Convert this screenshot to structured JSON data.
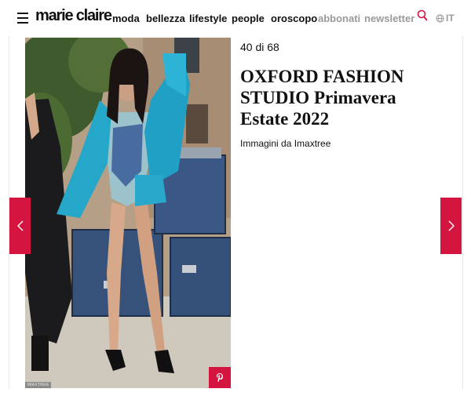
{
  "header": {
    "logo": "marie claire",
    "nav": [
      {
        "label": "moda",
        "muted": false
      },
      {
        "label": "bellezza",
        "muted": false
      },
      {
        "label": "lifestyle",
        "muted": false
      },
      {
        "label": "people",
        "muted": false
      },
      {
        "label": "oroscopo",
        "muted": false
      },
      {
        "label": "abbonati",
        "muted": true
      },
      {
        "label": "newsletter",
        "muted": true
      }
    ],
    "search_icon": "search-icon",
    "language": "IT"
  },
  "gallery": {
    "counter": "40 di 68",
    "title": "OXFORD FASHION STUDIO Primavera Estate 2022",
    "subtitle": "Immagini da Imaxtree",
    "photo_credit": "IMAXTREE",
    "prev_icon": "chevron-left-icon",
    "next_icon": "chevron-right-icon",
    "share_icon": "pinterest-icon"
  },
  "colors": {
    "accent": "#d3153f",
    "muted_text": "#9a9a9a"
  }
}
